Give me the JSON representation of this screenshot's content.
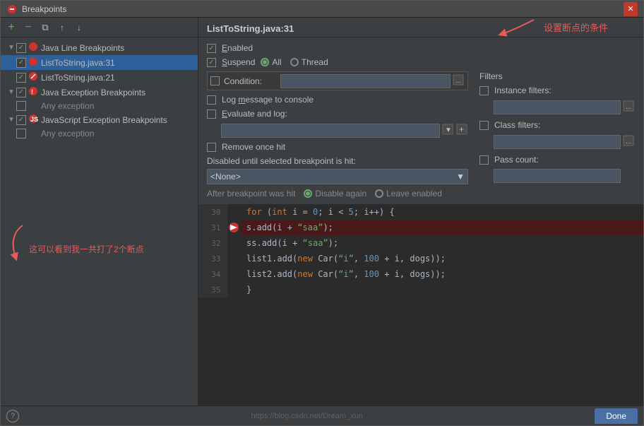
{
  "window": {
    "title": "Breakpoints",
    "close_label": "✕"
  },
  "toolbar": {
    "add": "+",
    "remove": "−",
    "copy": "⧉",
    "export": "↑",
    "import": "↓"
  },
  "tree": {
    "items": [
      {
        "id": "java-line-group",
        "label": "Java Line Breakpoints",
        "indent": 0,
        "type": "group",
        "checked": true,
        "expanded": true
      },
      {
        "id": "list-to-string-31",
        "label": "ListToString.java:31",
        "indent": 1,
        "type": "leaf",
        "checked": true,
        "selected": true
      },
      {
        "id": "list-to-string-21",
        "label": "ListToString.java:21",
        "indent": 1,
        "type": "leaf",
        "checked": true,
        "selected": false
      },
      {
        "id": "java-exception-group",
        "label": "Java Exception Breakpoints",
        "indent": 0,
        "type": "group",
        "checked": true,
        "expanded": true
      },
      {
        "id": "any-exception",
        "label": "Any exception",
        "indent": 1,
        "type": "leaf",
        "checked": false,
        "selected": false
      },
      {
        "id": "javascript-exception-group",
        "label": "JavaScript Exception Breakpoints",
        "indent": 0,
        "type": "group",
        "checked": true,
        "expanded": true
      },
      {
        "id": "any-exception-js",
        "label": "Any exception",
        "indent": 1,
        "type": "leaf",
        "checked": false,
        "selected": false
      }
    ]
  },
  "annotations": {
    "chinese_left": "这可以看到我一共打了2个断点",
    "chinese_right": "设置断点的条件",
    "remove_once_hit": "Remove once hit"
  },
  "right_panel": {
    "title": "ListToString.java:31",
    "enabled_label": "Enabled",
    "suspend_label": "Suspend",
    "all_label": "All",
    "thread_label": "Thread",
    "condition_label": "Condition:",
    "log_message_label": "Log message to console",
    "evaluate_label": "Evaluate and log:",
    "remove_once_hit_label": "Remove once hit",
    "disabled_until_label": "Disabled until selected breakpoint is hit:",
    "disabled_none": "<None>",
    "after_hit_label": "After breakpoint was hit",
    "disable_again_label": "Disable again",
    "leave_enabled_label": "Leave enabled",
    "filters": {
      "title": "Filters",
      "instance_label": "Instance filters:",
      "class_label": "Class filters:",
      "pass_count_label": "Pass count:"
    }
  },
  "code": {
    "lines": [
      {
        "num": "30",
        "bp": false,
        "highlight": false,
        "content_html": "<span class='code-keyword'>for</span> <span class='code-punct'>(</span><span class='code-keyword'>int</span> <span class='code-ident'>i</span> <span class='code-punct'>=</span> <span class='code-num'>0</span><span class='code-punct'>;</span> <span class='code-ident'>i</span> <span class='code-punct'>&lt;</span> <span class='code-num'>5</span><span class='code-punct'>;</span> <span class='code-ident'>i</span><span class='code-punct'>++)</span> <span class='code-punct'>{</span>"
      },
      {
        "num": "31",
        "bp": true,
        "highlight": true,
        "content_html": "<span class='code-ident'>s</span><span class='code-punct'>.</span><span class='code-ident'>add</span><span class='code-punct'>(</span><span class='code-ident'>i</span> <span class='code-punct'>+</span> <span class='code-string'>\"saa\"</span><span class='code-punct'>);</span>"
      },
      {
        "num": "32",
        "bp": false,
        "highlight": false,
        "content_html": "<span class='code-ident'>ss</span><span class='code-punct'>.</span><span class='code-ident'>add</span><span class='code-punct'>(</span><span class='code-ident'>i</span> <span class='code-punct'>+</span> <span class='code-string'>\"saa\"</span><span class='code-punct'>);</span>"
      },
      {
        "num": "33",
        "bp": false,
        "highlight": false,
        "content_html": "<span class='code-ident'>list1</span><span class='code-punct'>.</span><span class='code-ident'>add</span><span class='code-punct'>(</span><span class='code-keyword'>new</span> <span class='code-ident'>Car</span><span class='code-punct'>(</span><span class='code-string'>\"i\"</span><span class='code-punct'>,</span> <span class='code-num'>100</span> <span class='code-punct'>+</span> <span class='code-ident'>i</span><span class='code-punct'>,</span> <span class='code-ident'>dogs</span><span class='code-punct'>));</span>"
      },
      {
        "num": "34",
        "bp": false,
        "highlight": false,
        "content_html": "<span class='code-ident'>list2</span><span class='code-punct'>.</span><span class='code-ident'>add</span><span class='code-punct'>(</span><span class='code-keyword'>new</span> <span class='code-ident'>Car</span><span class='code-punct'>(</span><span class='code-string'>\"i\"</span><span class='code-punct'>,</span> <span class='code-num'>100</span> <span class='code-punct'>+</span> <span class='code-ident'>i</span><span class='code-punct'>,</span> <span class='code-ident'>dogs</span><span class='code-punct'>));</span>"
      },
      {
        "num": "35",
        "bp": false,
        "highlight": false,
        "content_html": "<span class='code-punct'>}</span>"
      }
    ]
  },
  "bottom": {
    "help": "?",
    "done": "Done",
    "url": "https://blog.csdn.net/Dream_xun"
  }
}
